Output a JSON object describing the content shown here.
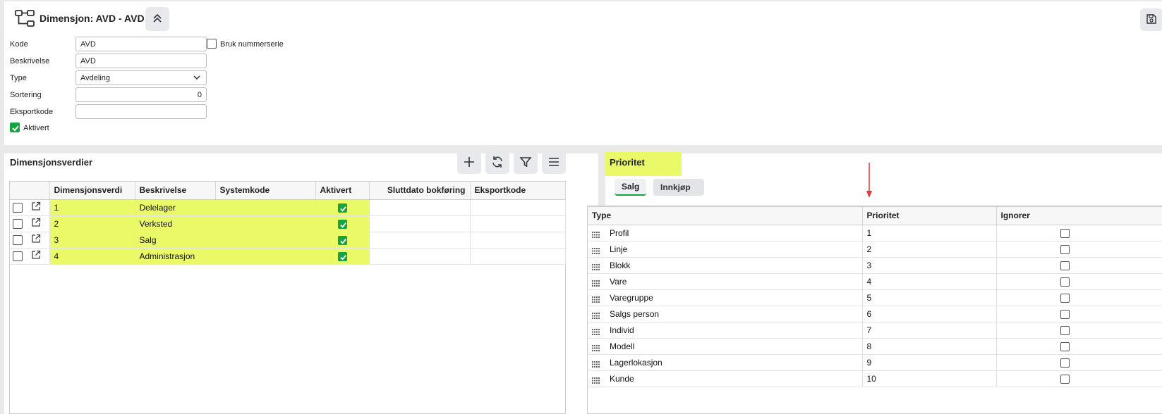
{
  "header": {
    "title": "Dimensjon: AVD - AVD",
    "icon": "hierarchy-icon",
    "collapse_icon": "chevrons-up-icon",
    "save_icon": "floppy-disk-icon"
  },
  "form": {
    "kode_label": "Kode",
    "kode_value": "AVD",
    "beskrivelse_label": "Beskrivelse",
    "beskrivelse_value": "AVD",
    "type_label": "Type",
    "type_value": "Avdeling",
    "sortering_label": "Sortering",
    "sortering_value": "0",
    "eksportkode_label": "Eksportkode",
    "eksportkode_value": "",
    "aktivert_label": "Aktivert",
    "aktivert_checked": true,
    "nummerserie_label": "Bruk nummerserie",
    "nummerserie_checked": false
  },
  "dimensjonsverdier": {
    "title": "Dimensjonsverdier",
    "toolbar": [
      "plus-icon",
      "refresh-icon",
      "filter-icon",
      "menu-icon"
    ],
    "columns": [
      "Dimensjonsverdi",
      "Beskrivelse",
      "Systemkode",
      "Aktivert",
      "Sluttdato bokføring",
      "Eksportkode"
    ],
    "rows": [
      {
        "verdi": "1",
        "beskrivelse": "Delelager",
        "systemkode": "",
        "aktivert": true,
        "sluttdato": "",
        "eksportkode": ""
      },
      {
        "verdi": "2",
        "beskrivelse": "Verksted",
        "systemkode": "",
        "aktivert": true,
        "sluttdato": "",
        "eksportkode": ""
      },
      {
        "verdi": "3",
        "beskrivelse": "Salg",
        "systemkode": "",
        "aktivert": true,
        "sluttdato": "",
        "eksportkode": ""
      },
      {
        "verdi": "4",
        "beskrivelse": "Administrasjon",
        "systemkode": "",
        "aktivert": true,
        "sluttdato": "",
        "eksportkode": ""
      }
    ]
  },
  "prioritet": {
    "title": "Prioritet",
    "tabs": [
      {
        "label": "Salg",
        "active": true
      },
      {
        "label": "Innkjøp",
        "active": false
      }
    ],
    "columns": [
      "Type",
      "Prioritet",
      "Ignorer"
    ],
    "rows": [
      {
        "type": "Profil",
        "prioritet": "1",
        "ignorer": false
      },
      {
        "type": "Linje",
        "prioritet": "2",
        "ignorer": false
      },
      {
        "type": "Blokk",
        "prioritet": "3",
        "ignorer": false
      },
      {
        "type": "Vare",
        "prioritet": "4",
        "ignorer": false
      },
      {
        "type": "Varegruppe",
        "prioritet": "5",
        "ignorer": false
      },
      {
        "type": "Salgs person",
        "prioritet": "6",
        "ignorer": false
      },
      {
        "type": "Individ",
        "prioritet": "7",
        "ignorer": false
      },
      {
        "type": "Modell",
        "prioritet": "8",
        "ignorer": false
      },
      {
        "type": "Lagerlokasjon",
        "prioritet": "9",
        "ignorer": false
      },
      {
        "type": "Kunde",
        "prioritet": "10",
        "ignorer": false
      }
    ]
  },
  "colors": {
    "highlight": "#e9f968",
    "accent_green": "#17a340",
    "annotation_arrow": "#e0393e"
  }
}
